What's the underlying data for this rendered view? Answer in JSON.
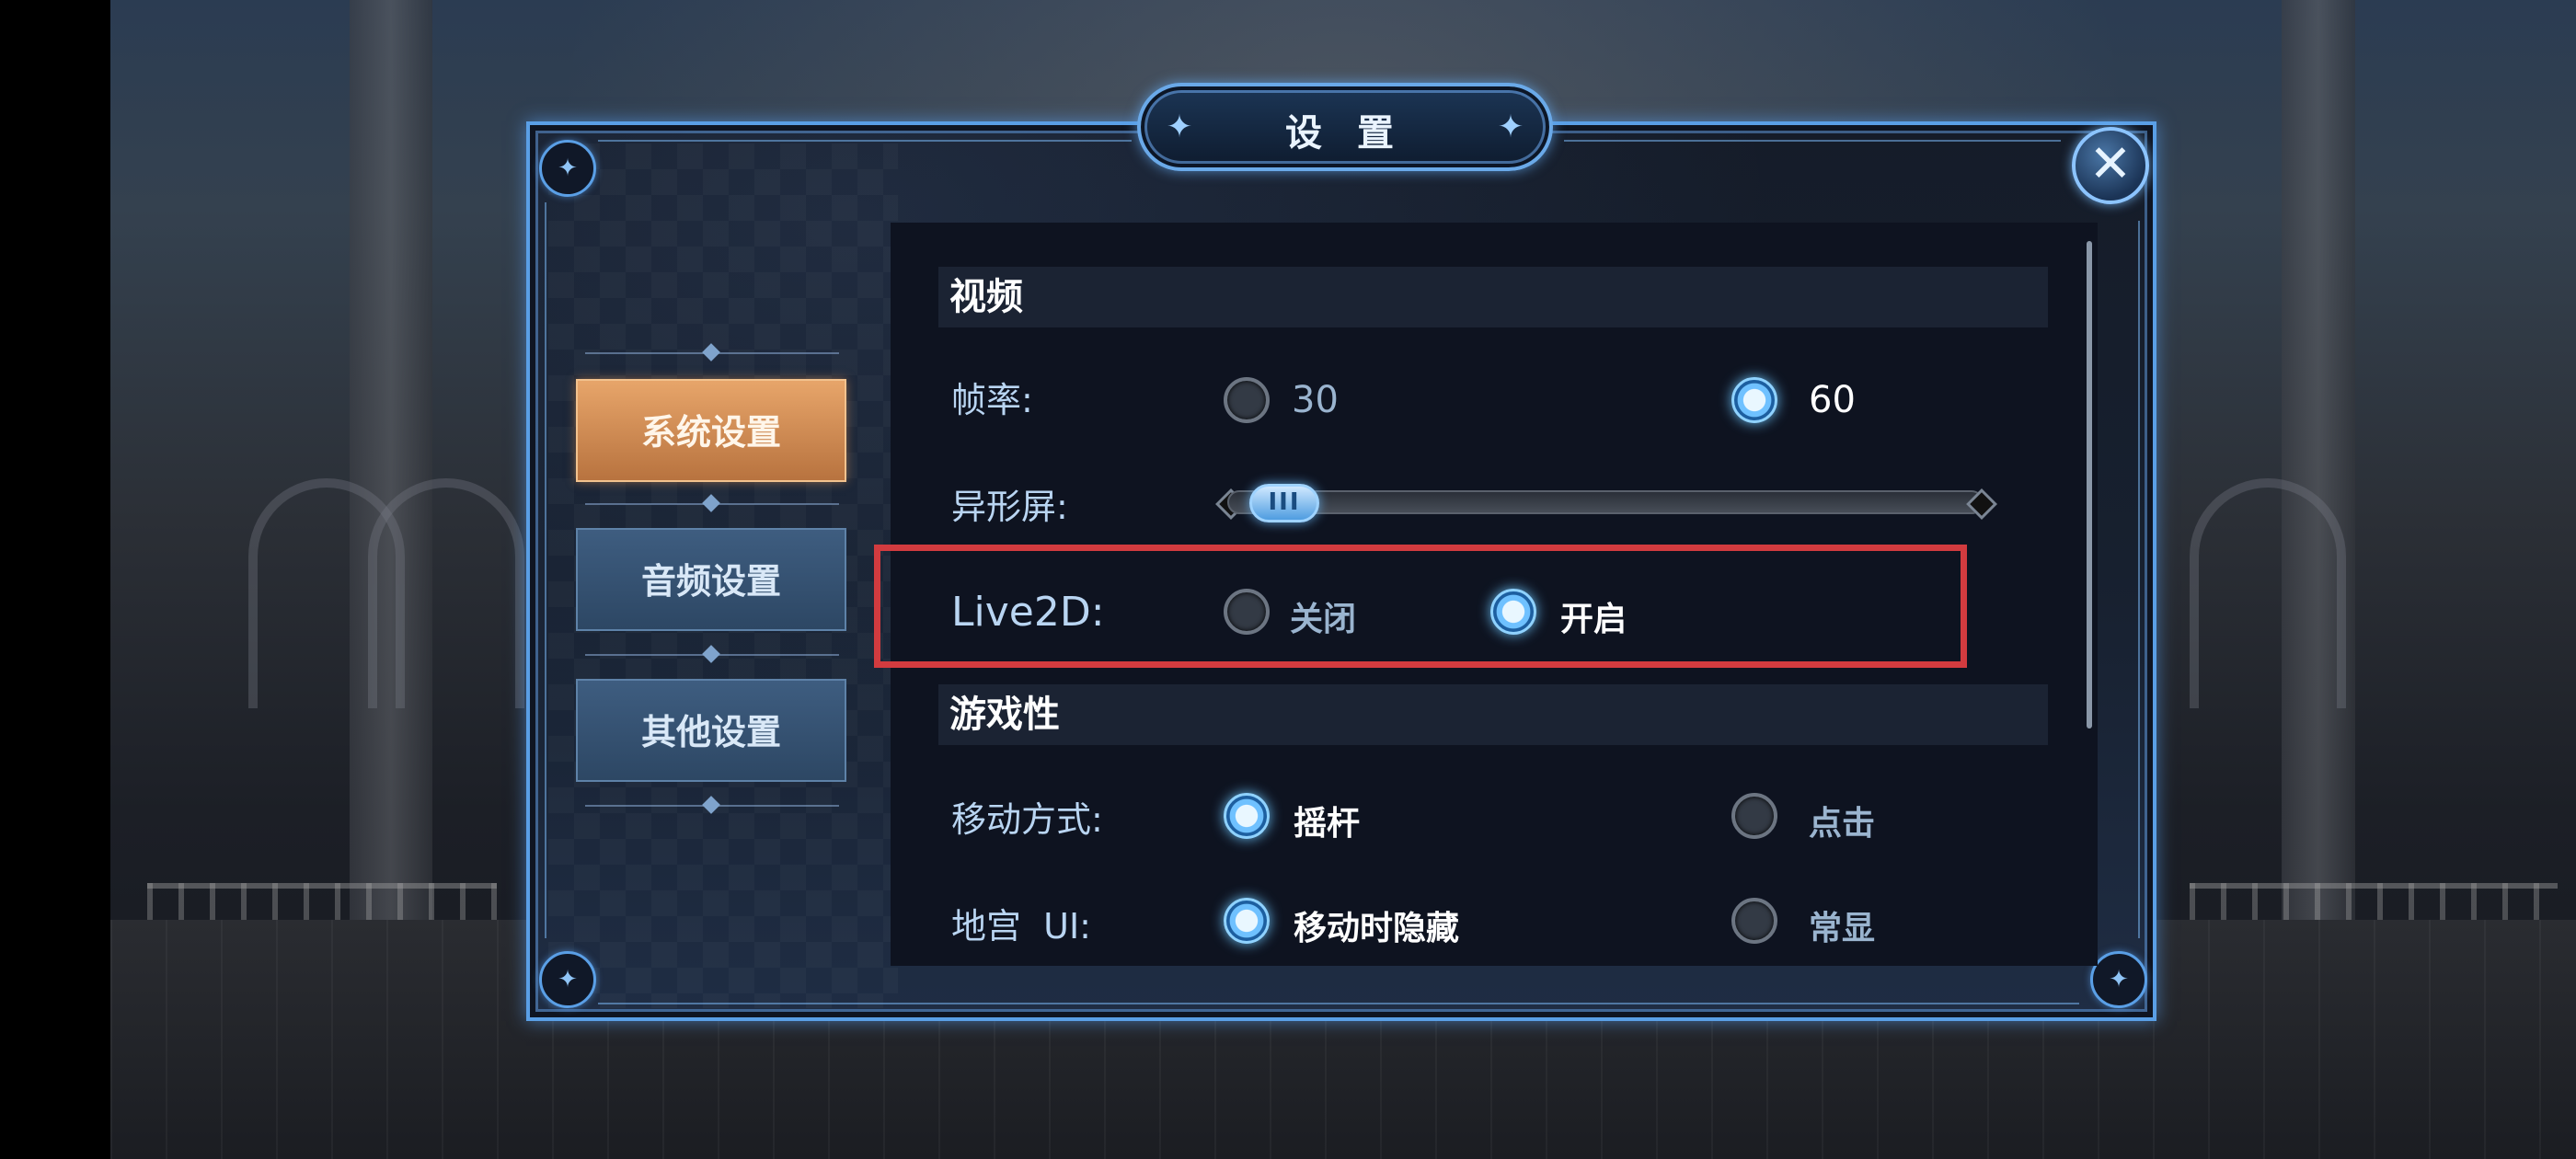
{
  "dialog": {
    "title": "设 置"
  },
  "sidebar": {
    "items": [
      {
        "label": "系统设置",
        "active": true
      },
      {
        "label": "音频设置",
        "active": false
      },
      {
        "label": "其他设置",
        "active": false
      }
    ]
  },
  "sections": {
    "video": {
      "header": "视频",
      "frame_rate": {
        "label": "帧率:",
        "options": [
          "30",
          "60"
        ],
        "selected": "60"
      },
      "notch_screen": {
        "label": "异形屏:",
        "value_fraction": 0.05
      },
      "live2d": {
        "label": "Live2D:",
        "options": [
          "关闭",
          "开启"
        ],
        "selected": "开启"
      }
    },
    "gameplay": {
      "header": "游戏性",
      "move_mode": {
        "label": "移动方式:",
        "options": [
          "摇杆",
          "点击"
        ],
        "selected": "摇杆"
      },
      "dungeon_ui": {
        "label": "地宫  UI:",
        "options": [
          "移动时隐藏",
          "常显"
        ],
        "selected": "移动时隐藏"
      }
    }
  },
  "colors": {
    "accent_blue": "#5a9fe6",
    "active_tab": "#d8955a",
    "highlight_red": "#d23b3f"
  },
  "icons": {
    "close": "close-x-icon",
    "title_ornament": "star-compass-icon",
    "corner_ornament": "star-compass-icon"
  }
}
